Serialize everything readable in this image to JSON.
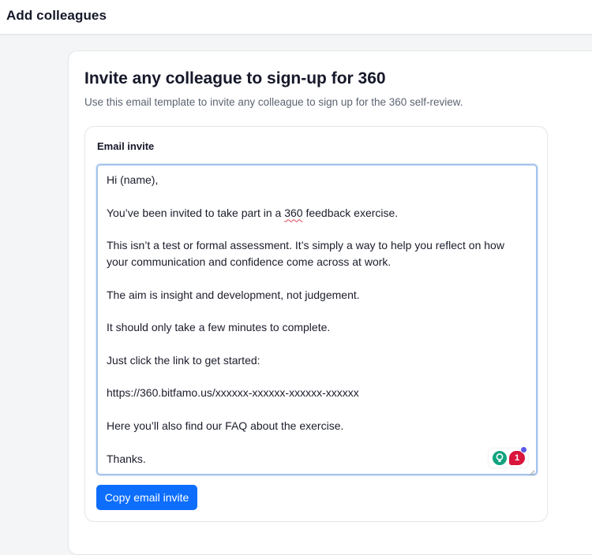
{
  "header": {
    "title": "Add colleagues"
  },
  "card": {
    "heading": "Invite any colleague to sign-up for 360",
    "subtitle": "Use this email template to invite any colleague to sign up for the 360 self-review."
  },
  "email": {
    "label": "Email invite",
    "lines": [
      "Hi (name),",
      "",
      "You’ve been invited to take part in a ",
      "",
      "This isn’t a test or formal assessment. It’s simply a way to help you reflect on how",
      "your communication and confidence come across at work.",
      "",
      "The aim is insight and development, not judgement.",
      "",
      "It should only take a few minutes to complete.",
      "",
      "Just click the link to get started:",
      "",
      "https://360.bitfamo.us/xxxxxx-xxxxxx-xxxxxx-xxxxxx",
      "",
      "Here you’ll also find our FAQ about the exercise.",
      "",
      "Thanks."
    ],
    "line3_flagged_word": "360",
    "line3_rest": " feedback exercise.",
    "extension_badge_count": "1",
    "copy_button_label": "Copy email invite"
  },
  "colors": {
    "primary_button": "#0d6efd",
    "textarea_focus_border": "#a6c4ec",
    "spellcheck_underline": "#e0455a",
    "extension_bulb": "#12a37f",
    "extension_badge": "#d9153c"
  }
}
